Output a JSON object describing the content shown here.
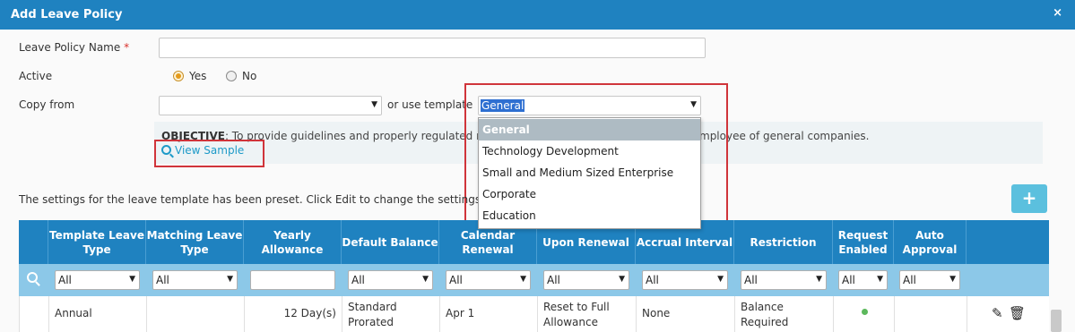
{
  "dialog": {
    "title": "Add Leave Policy",
    "close_glyph": "×"
  },
  "form": {
    "policy_name_label": "Leave Policy Name",
    "required_mark": "*",
    "policy_name_value": "",
    "active_label": "Active",
    "active_yes": "Yes",
    "active_no": "No",
    "active_selected": "Yes",
    "copy_from_label": "Copy from",
    "copy_from_value": "",
    "or_use_template": "or use template",
    "template_value": "General",
    "template_options": [
      "General",
      "Technology Development",
      "Small and Medium Sized Enterprise",
      "Corporate",
      "Education"
    ]
  },
  "objective": {
    "label": "OBJECTIVE",
    "text_left": ": To provide guidelines and properly regulated rul",
    "text_right": "mployee of general companies.",
    "view_sample": "View Sample"
  },
  "settings_text": "The settings for the leave template has been preset. Click Edit to change the settings ac",
  "add_button": "+",
  "table": {
    "headers": [
      "Template Leave Type",
      "Matching Leave Type",
      "Yearly Allowance",
      "Default Balance",
      "Calendar Renewal",
      "Upon Renewal",
      "Accrual Interval",
      "Restriction",
      "Request Enabled",
      "Auto Approval"
    ],
    "filter_all": "All",
    "row": {
      "template_leave_type": "Annual",
      "matching_leave_type": "",
      "yearly_allowance": "12 Day(s)",
      "default_balance_1": "Standard",
      "default_balance_2": "Prorated",
      "calendar_renewal": "Apr 1",
      "upon_renewal_1": "Reset to Full",
      "upon_renewal_2": "Allowance",
      "accrual_interval": "None",
      "restriction_1": "Balance",
      "restriction_2": "Required",
      "request_enabled": true,
      "auto_approval": false
    }
  },
  "colors": {
    "header": "#1f82c0",
    "filter_row": "#8cc8e8",
    "highlight_box": "#d0343a",
    "link": "#1d9ac8",
    "add_button": "#5bc0de"
  }
}
